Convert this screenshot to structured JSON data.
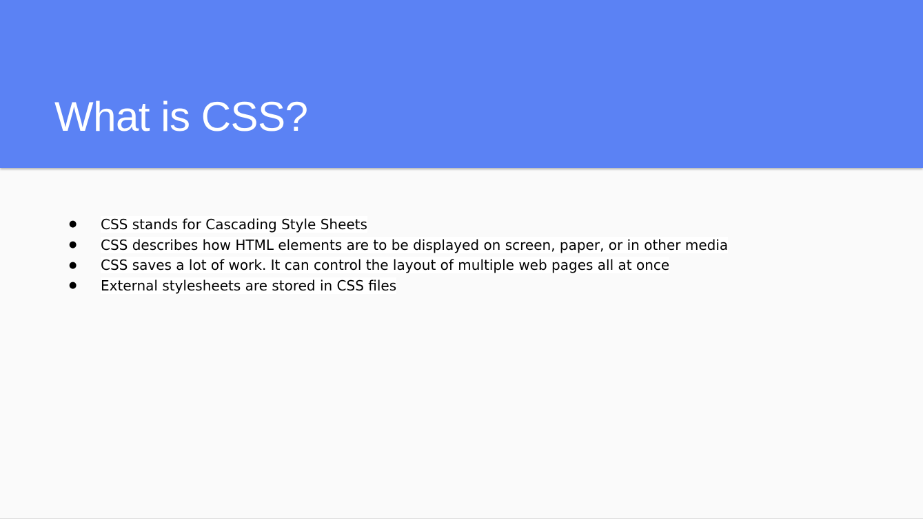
{
  "slide": {
    "title": "What is CSS?",
    "bullets": [
      {
        "marker": "●",
        "text": "CSS stands for Cascading Style Sheets"
      },
      {
        "marker": "●",
        "text": "CSS describes how HTML elements are to be displayed on screen, paper, or in other media"
      },
      {
        "marker": "●",
        "text": "CSS saves a lot of work. It can control the layout of multiple web pages all at once"
      },
      {
        "marker": "●",
        "text": "External stylesheets are stored in CSS files"
      }
    ]
  },
  "colors": {
    "header_background": "#5b82f4",
    "title_text": "#ffffff",
    "body_background": "#fafafa",
    "body_text": "#000000"
  }
}
